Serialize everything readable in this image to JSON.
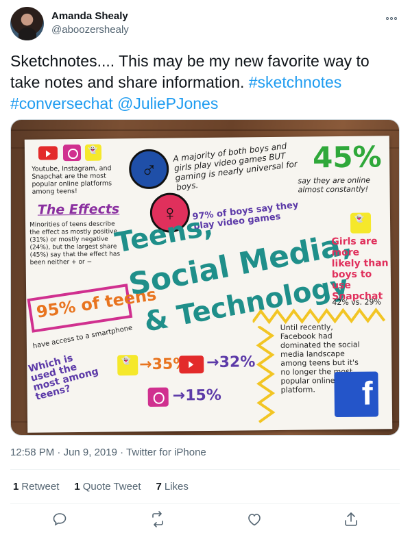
{
  "author": {
    "display_name": "Amanda Shealy",
    "handle": "@aboozershealy",
    "avatar": "avatar-photo",
    "more_icon": "more-horizontal-icon"
  },
  "tweet": {
    "text_plain": "Sketchnotes.... This may be my new favorite way to take notes and share information. ",
    "tags": [
      "#sketchnotes",
      "#conversechat",
      "@JuliePJones"
    ]
  },
  "image": {
    "description_text": {
      "platforms_note": "Youtube, Instagram, and Snapchat are the most popular online platforms among teens!",
      "effects_heading": "The Effects",
      "effects_text": "Minorities of teens describe the effect as mostly positive (31%) or mostly negative (24%), but the largest share (45%) say that the effect has been neither + or −",
      "percent_95": "95% of teens",
      "smartphone_text": "have access to a smartphone",
      "which_used": "Which is used the most among teens?",
      "stat_snap": "→35%",
      "stat_yt": "→32%",
      "stat_ig": "→15%",
      "gaming_text": "A majority of both boys and girls play video games BUT gaming is nearly universal for boys.",
      "boys_stat": "97% of boys say they play video games",
      "percent_45": "45%",
      "constantly": "say they are online almost constantly!",
      "title_1": "Teens,",
      "title_2": "Social Media,",
      "title_3": "& Technology",
      "girls_text": "Girls are more likely than boys to use Snapchat",
      "girls_stat": "42% vs. 29%",
      "facebook_text": "Until recently, Facebook had dominated the social media landscape among teens but it's no longer the most popular online platform."
    }
  },
  "meta": {
    "time": "12:58 PM",
    "separator": "·",
    "date": "Jun 9, 2019",
    "source": "Twitter for iPhone"
  },
  "stats": [
    {
      "count": "1",
      "label": "Retweet"
    },
    {
      "count": "1",
      "label": "Quote Tweet"
    },
    {
      "count": "7",
      "label": "Likes"
    }
  ],
  "actions": [
    "reply-icon",
    "retweet-icon",
    "like-icon",
    "share-icon"
  ],
  "colors": {
    "link": "#1d9bf0",
    "secondary": "#536471",
    "teal": "#1f8f8a",
    "purple": "#7a2a8a",
    "green": "#2fa83a"
  }
}
